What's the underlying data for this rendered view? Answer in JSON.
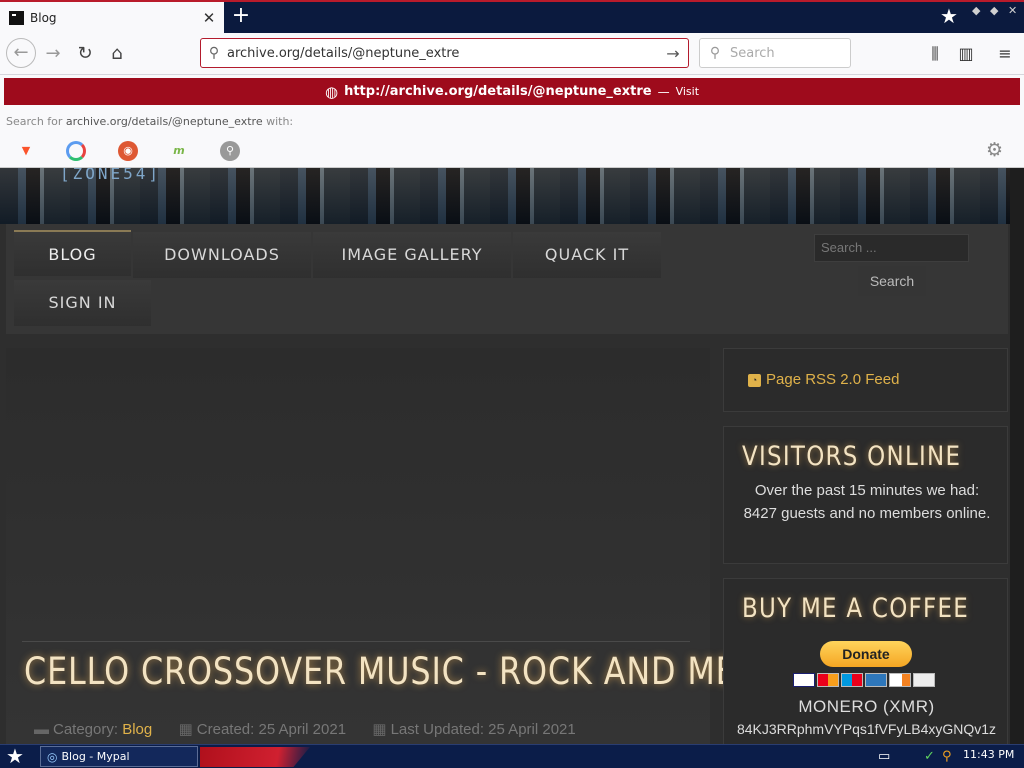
{
  "browser": {
    "tab_title": "Blog",
    "url_value": "archive.org/details/@neptune_extre",
    "search_placeholder": "Search"
  },
  "dropdown": {
    "visit_url_prefix": "http://",
    "visit_url_bold": "archive.org/details/@neptune_extre",
    "visit_sep": "—",
    "visit_label": "Visit",
    "search_for_prefix": "Search for ",
    "search_for_query": "archive.org/details/@neptune_extre",
    "search_for_suffix": " with:",
    "engines": [
      "brave-icon",
      "qwant-icon",
      "duckduckgo-icon",
      "mojeek-icon",
      "search-engine-icon"
    ]
  },
  "site": {
    "banner_logo": "[ZONE54]",
    "menu": {
      "blog": "BLOG",
      "downloads": "DOWNLOADS",
      "gallery": "IMAGE GALLERY",
      "quack": "QUACK IT",
      "signin": "SIGN IN"
    },
    "search_placeholder": "Search ...",
    "search_button": "Search",
    "article": {
      "title": "CELLO CROSSOVER MUSIC - ROCK AND METAL",
      "category_label": "Category:",
      "category_value": "Blog",
      "created": "Created: 25 April 2021",
      "updated": "Last Updated: 25 April 2021"
    },
    "rss_link": "Page RSS 2.0 Feed",
    "visitors": {
      "title": "VISITORS ONLINE",
      "text": "Over the past 15 minutes we had: 8427 guests and no members online."
    },
    "coffee": {
      "title": "BUY ME A COFFEE",
      "donate_label": "Donate",
      "monero_label": "MONERO (XMR)",
      "monero_address": "84KJ3RRphmVYPqs1fVFyLB4xyGNQv1z"
    }
  },
  "taskbar": {
    "task_label": "Blog - Mypal",
    "clock": "11:43 PM"
  },
  "colors": {
    "accent_red": "#9e0b1c",
    "link_gold": "#e0b24a",
    "heading_cream": "#f3e3c2"
  }
}
